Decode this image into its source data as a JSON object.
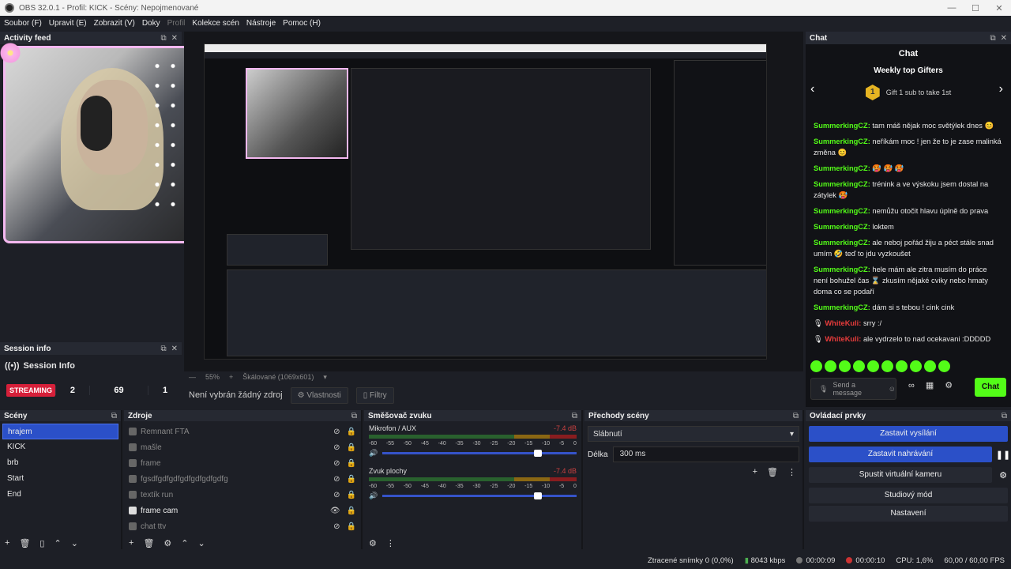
{
  "window": {
    "title": "OBS 32.0.1 - Profil: KICK - Scény: Nepojmenované"
  },
  "menu": [
    "Soubor (F)",
    "Upravit (E)",
    "Zobrazit (V)",
    "Doky",
    "Profil",
    "Kolekce scén",
    "Nástroje",
    "Pomoc (H)"
  ],
  "activity": {
    "title": "Activity feed"
  },
  "session": {
    "dock_title": "Session info",
    "title": "Session Info",
    "badge": "STREAMING",
    "values": [
      "2",
      "69",
      "1"
    ]
  },
  "preview": {
    "zoom": "55%",
    "scale_label": "Škálované (1069x601)",
    "no_source": "Není vybrán žádný zdroj",
    "props_label": "Vlastnosti",
    "filters_label": "Filtry"
  },
  "chat": {
    "dock_title": "Chat",
    "title": "Chat",
    "gifters_title": "Weekly top Gifters",
    "gift_badge": "1",
    "gift_text": "Gift 1 sub to take 1st",
    "messages": [
      {
        "user": "SummerkingCZ:",
        "text": "tam máš nějak moc světýlek dnes 😊"
      },
      {
        "user": "SummerkingCZ:",
        "text": "neříkám moc ! jen že to je zase malinká změna 😊"
      },
      {
        "user": "SummerkingCZ:",
        "text": "🥵 🥵 🥵"
      },
      {
        "user": "SummerkingCZ:",
        "text": "trénink a ve výskoku jsem dostal na zátylek 🥵"
      },
      {
        "user": "SummerkingCZ:",
        "text": "nemůžu otočit hlavu úplně do prava"
      },
      {
        "user": "SummerkingCZ:",
        "text": "loktem"
      },
      {
        "user": "SummerkingCZ:",
        "text": "ale neboj pořád žiju a péct stále snad umím 🤣 teď to jdu vyzkoušet"
      },
      {
        "user": "SummerkingCZ:",
        "text": "hele mám ale zitra musím do práce není bohužel čas ⌛ zkusím nějaké cviky nebo hmaty doma co se podaří"
      },
      {
        "user": "SummerkingCZ:",
        "text": "dám si s tebou ! cink cink"
      },
      {
        "user": "WhiteKuli:",
        "text": "srry :/",
        "red": true
      },
      {
        "user": "WhiteKuli:",
        "text": "ale vydrzelo to nad ocekavani :DDDDD",
        "red": true
      }
    ],
    "input_placeholder": "Send a message",
    "send_label": "Chat"
  },
  "scenes": {
    "title": "Scény",
    "items": [
      "hrajem",
      "KICK",
      "brb",
      "Start",
      "End"
    ],
    "selected": 0
  },
  "sources": {
    "title": "Zdroje",
    "items": [
      "Remnant FTA",
      "mašle",
      "frame",
      "fgsdfgdfgdfgdfgdfgdfgdfg",
      "textík run",
      "frame cam",
      "chat ttv"
    ],
    "active": [
      5
    ]
  },
  "mixer": {
    "title": "Směšovač zvuku",
    "tracks": [
      {
        "name": "Mikrofon / AUX",
        "db": "-7.4 dB"
      },
      {
        "name": "Zvuk plochy",
        "db": "-7.4 dB"
      }
    ],
    "scale": [
      "-60",
      "-55",
      "-50",
      "-45",
      "-40",
      "-35",
      "-30",
      "-25",
      "-20",
      "-15",
      "-10",
      "-5",
      "0"
    ]
  },
  "transitions": {
    "title": "Přechody scény",
    "selected": "Slábnutí",
    "duration_label": "Délka",
    "duration": "300 ms"
  },
  "controls": {
    "title": "Ovládací prvky",
    "buttons": [
      "Zastavit vysílání",
      "Zastavit nahrávání",
      "Spustit virtuální kameru",
      "Studiový mód",
      "Nastavení"
    ]
  },
  "status": {
    "dropped": "Ztracené snímky 0 (0,0%)",
    "bitrate": "8043 kbps",
    "stream_time": "00:00:09",
    "rec_time": "00:00:10",
    "cpu": "CPU: 1,6%",
    "fps": "60,00 / 60,00 FPS"
  }
}
